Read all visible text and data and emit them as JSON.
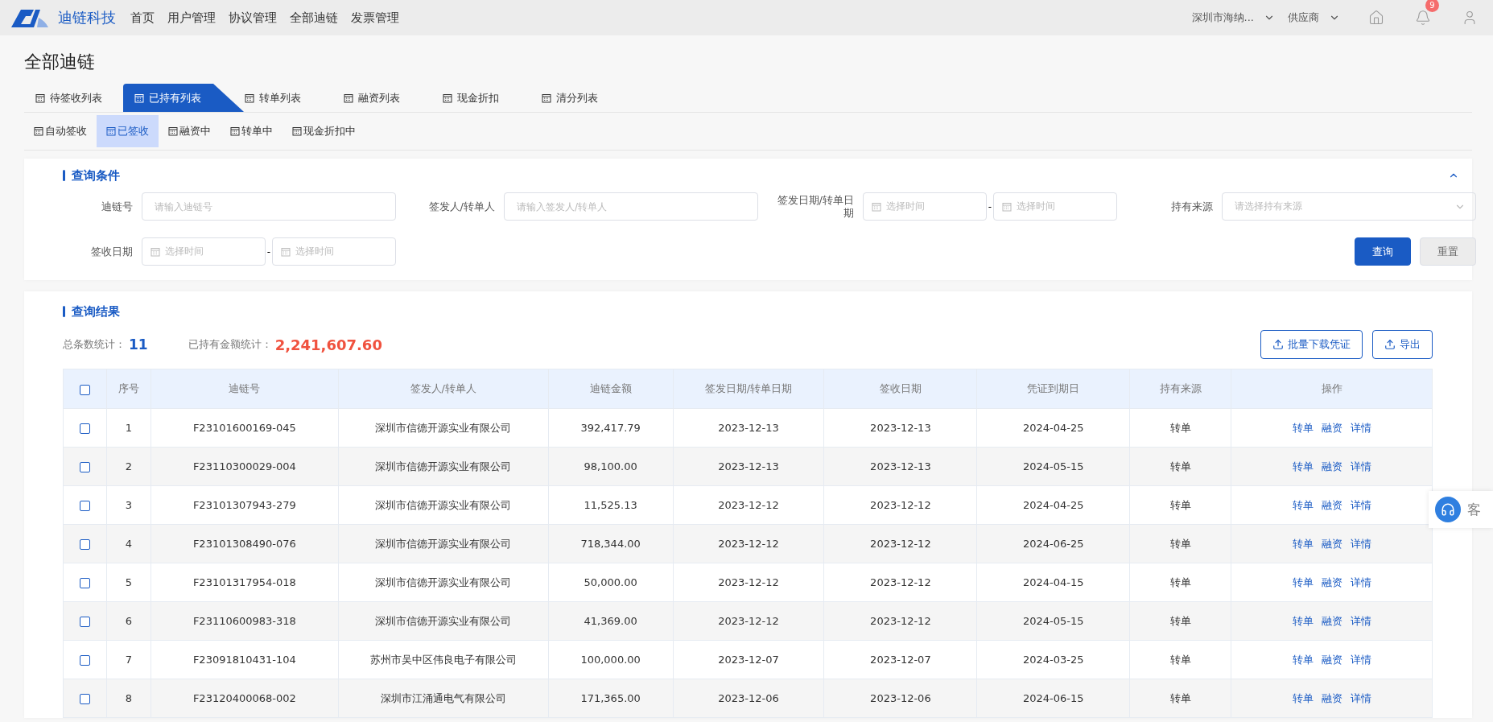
{
  "topbar": {
    "brand": "迪链科技",
    "nav": [
      {
        "label": "首页",
        "selected": false
      },
      {
        "label": "用户管理",
        "selected": false
      },
      {
        "label": "协议管理",
        "selected": false
      },
      {
        "label": "全部迪链",
        "selected": false
      },
      {
        "label": "发票管理",
        "selected": false
      }
    ],
    "company": "深圳市海纳...",
    "role": "供应商",
    "notifications": "9"
  },
  "page_title": "全部迪链",
  "tabs": [
    {
      "label": "待签收列表",
      "selected": false
    },
    {
      "label": "已持有列表",
      "selected": true
    },
    {
      "label": "转单列表",
      "selected": false
    },
    {
      "label": "融资列表",
      "selected": false
    },
    {
      "label": "现金折扣",
      "selected": false
    },
    {
      "label": "清分列表",
      "selected": false
    }
  ],
  "subtabs": [
    {
      "label": "自动签收",
      "selected": false
    },
    {
      "label": "已签收",
      "selected": true
    },
    {
      "label": "融资中",
      "selected": false
    },
    {
      "label": "转单中",
      "selected": false
    },
    {
      "label": "现金折扣中",
      "selected": false
    }
  ],
  "query": {
    "title": "查询条件",
    "expanded": true,
    "fields": [
      {
        "kind": "text",
        "label": "迪链号",
        "placeholder": "请输入迪链号"
      },
      {
        "kind": "text",
        "label": "签发人/转单人",
        "placeholder": "请输入签发人/转单人"
      },
      {
        "kind": "daterange",
        "label": "签发日期/转单日期",
        "placeholder_start": "选择时间",
        "separator": "-",
        "placeholder_end": "选择时间"
      },
      {
        "kind": "select",
        "label": "持有来源",
        "placeholder": "请选择持有来源"
      },
      {
        "kind": "daterange",
        "label": "签收日期",
        "placeholder_start": "选择时间",
        "separator": "-",
        "placeholder_end": "选择时间"
      }
    ],
    "buttons": [
      {
        "kind": "primary",
        "label": "查询"
      },
      {
        "kind": "secondary",
        "label": "重置"
      }
    ]
  },
  "results": {
    "title": "查询结果",
    "count_label": "总条数统计：",
    "count": "11",
    "amount_label": "已持有金额统计：",
    "amount": "2,241,607.60",
    "buttons": [
      "批量下载凭证",
      "导出"
    ],
    "header_checked": false,
    "columns": [
      "序号",
      "迪链号",
      "签发人/转单人",
      "迪链金额",
      "签发日期/转单日期",
      "签收日期",
      "凭证到期日",
      "持有来源",
      "操作"
    ],
    "rows": [
      {
        "checked": false,
        "cells": [
          "1",
          "F23101600169-045",
          "深圳市信德开源实业有限公司",
          "392,417.79",
          "2023-12-13",
          "2023-12-13",
          "2024-04-25",
          "转单"
        ],
        "actions": [
          "转单",
          "融资",
          "详情"
        ]
      },
      {
        "checked": false,
        "cells": [
          "2",
          "F23110300029-004",
          "深圳市信德开源实业有限公司",
          "98,100.00",
          "2023-12-13",
          "2023-12-13",
          "2024-05-15",
          "转单"
        ],
        "actions": [
          "转单",
          "融资",
          "详情"
        ]
      },
      {
        "checked": false,
        "cells": [
          "3",
          "F23101307943-279",
          "深圳市信德开源实业有限公司",
          "11,525.13",
          "2023-12-12",
          "2023-12-12",
          "2024-04-25",
          "转单"
        ],
        "actions": [
          "转单",
          "融资",
          "详情"
        ]
      },
      {
        "checked": false,
        "cells": [
          "4",
          "F23101308490-076",
          "深圳市信德开源实业有限公司",
          "718,344.00",
          "2023-12-12",
          "2023-12-12",
          "2024-06-25",
          "转单"
        ],
        "actions": [
          "转单",
          "融资",
          "详情"
        ]
      },
      {
        "checked": false,
        "cells": [
          "5",
          "F23101317954-018",
          "深圳市信德开源实业有限公司",
          "50,000.00",
          "2023-12-12",
          "2023-12-12",
          "2024-04-15",
          "转单"
        ],
        "actions": [
          "转单",
          "融资",
          "详情"
        ]
      },
      {
        "checked": false,
        "cells": [
          "6",
          "F23110600983-318",
          "深圳市信德开源实业有限公司",
          "41,369.00",
          "2023-12-12",
          "2023-12-12",
          "2024-05-15",
          "转单"
        ],
        "actions": [
          "转单",
          "融资",
          "详情"
        ]
      },
      {
        "checked": false,
        "cells": [
          "7",
          "F23091810431-104",
          "苏州市吴中区伟良电子有限公司",
          "100,000.00",
          "2023-12-07",
          "2023-12-07",
          "2024-03-25",
          "转单"
        ],
        "actions": [
          "转单",
          "融资",
          "详情"
        ]
      },
      {
        "checked": false,
        "cells": [
          "8",
          "F23120400068-002",
          "深圳市江涌通电气有限公司",
          "171,365.00",
          "2023-12-06",
          "2023-12-06",
          "2024-06-15",
          "转单"
        ],
        "actions": [
          "转单",
          "融资",
          "详情"
        ]
      }
    ]
  },
  "support": {
    "label": "客"
  }
}
